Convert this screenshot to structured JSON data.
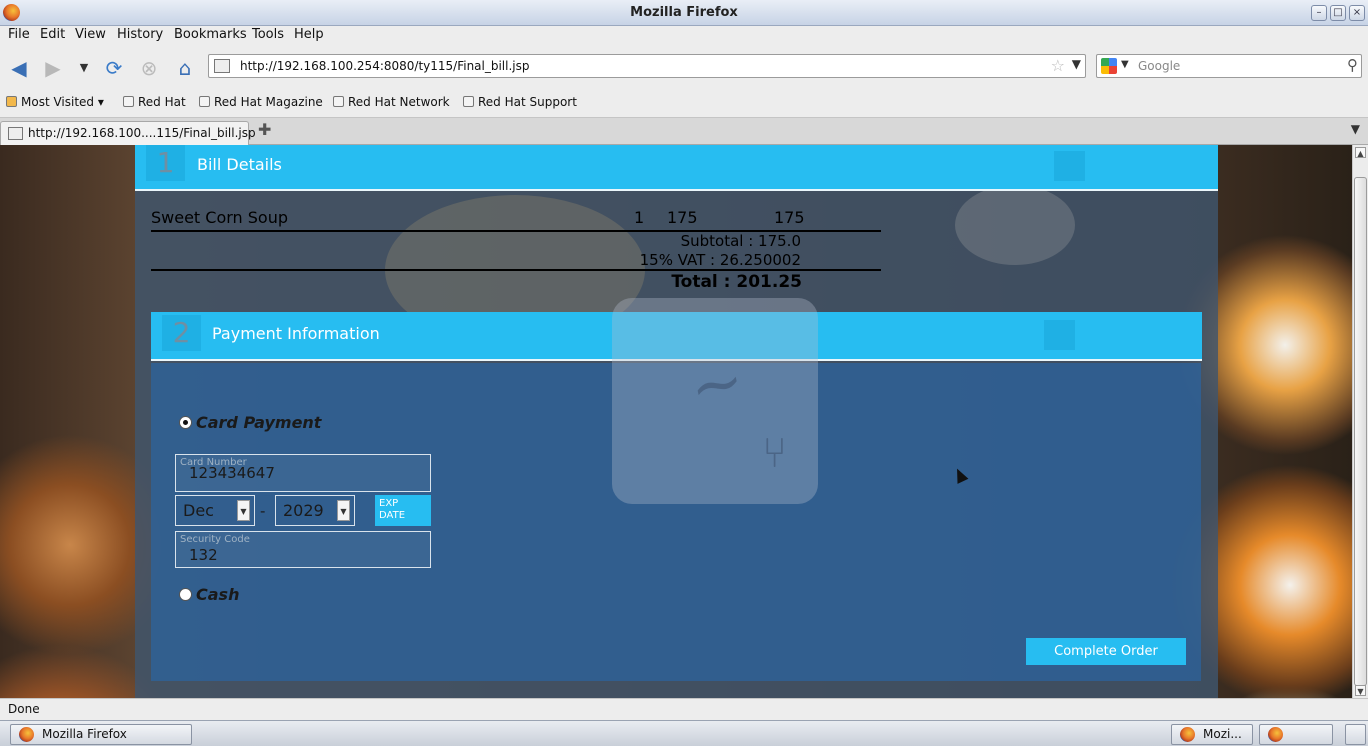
{
  "window": {
    "title": "Mozilla Firefox"
  },
  "menu": {
    "file": "File",
    "edit": "Edit",
    "view": "View",
    "history": "History",
    "bookmarks": "Bookmarks",
    "tools": "Tools",
    "help": "Help"
  },
  "toolbar": {
    "url": "http://192.168.100.254:8080/ty115/Final_bill.jsp",
    "search_placeholder": "Google"
  },
  "bookmarks_bar": {
    "most_visited": "Most Visited",
    "items": [
      "Red Hat",
      "Red Hat Magazine",
      "Red Hat Network",
      "Red Hat Support"
    ]
  },
  "tab": {
    "label": "http://192.168.100....115/Final_bill.jsp"
  },
  "bill_section": {
    "number": "1",
    "title": "Bill Details",
    "items": [
      {
        "name": "Sweet Corn Soup",
        "qty": "1",
        "price": "175",
        "amount": "175"
      }
    ],
    "subtotal": "Subtotal : 175.0",
    "vat": "15% VAT : 26.250002",
    "total": "Total : 201.25"
  },
  "payment_section": {
    "number": "2",
    "title": "Payment Information",
    "card_option": "Card Payment",
    "card_selected": true,
    "card_number_label": "Card Number",
    "card_number": "123434647",
    "exp_month": "Dec",
    "exp_separator": "-",
    "exp_year": "2029",
    "exp_badge": "EXP DATE",
    "security_label": "Security Code",
    "security_code": "132",
    "cash_option": "Cash",
    "complete_button": "Complete Order"
  },
  "status": {
    "text": "Done"
  },
  "taskbar": {
    "item1": "Mozilla Firefox",
    "item2": "Mozi..."
  },
  "icons": {
    "back": "back-arrow-icon",
    "forward": "forward-arrow-icon",
    "reload": "reload-icon",
    "stop": "stop-icon",
    "home": "home-icon",
    "bookmark_star": "star-icon",
    "search": "magnifier-icon"
  },
  "colors": {
    "accent": "#27bdf1",
    "panel": "#2b64a0"
  }
}
